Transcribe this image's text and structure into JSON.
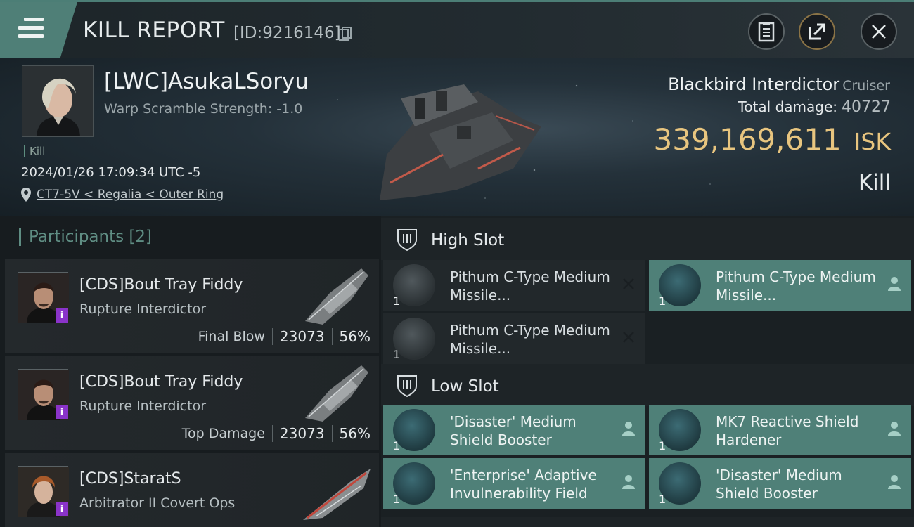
{
  "topbar": {
    "title": "KILL REPORT",
    "report_id": "[ID:9216146]",
    "icons": [
      "menu-icon",
      "copy-icon",
      "clipboard-icon",
      "share-icon",
      "close-icon"
    ]
  },
  "victim": {
    "name": "[LWC]AsukaLSoryu",
    "warp_scramble": "Warp Scramble Strength: -1.0",
    "kill_tag": "Kill",
    "datetime": "2024/01/26 17:09:34 UTC -5",
    "location": "CT7-5V < Regalia < Outer Ring",
    "ship_name": "Blackbird Interdictor",
    "ship_class": "Cruiser",
    "total_damage_label": "Total damage:",
    "total_damage": "40727",
    "isk_value": "339,169,611",
    "isk_unit": "ISK",
    "result": "Kill"
  },
  "participants": {
    "label": "Participants",
    "count": "[2]",
    "items": [
      {
        "name": "[CDS]Bout Tray Fiddy",
        "ship": "Rupture Interdictor",
        "role": "Final Blow",
        "damage": "23073",
        "percent": "56%"
      },
      {
        "name": "[CDS]Bout Tray Fiddy",
        "ship": "Rupture Interdictor",
        "role": "Top Damage",
        "damage": "23073",
        "percent": "56%"
      },
      {
        "name": "[CDS]StaratS",
        "ship": "Arbitrator II Covert Ops",
        "role": "",
        "damage": "",
        "percent": ""
      }
    ],
    "badge": "i"
  },
  "slots": {
    "high": {
      "label": "High Slot",
      "modules": [
        {
          "qty": "1",
          "name": "Pithum C-Type Medium Missile...",
          "state": "destroyed"
        },
        {
          "qty": "1",
          "name": "Pithum C-Type Medium Missile...",
          "state": "dropped"
        },
        {
          "qty": "1",
          "name": "Pithum C-Type Medium Missile...",
          "state": "destroyed"
        }
      ]
    },
    "low": {
      "label": "Low Slot",
      "modules": [
        {
          "qty": "1",
          "name": "'Disaster' Medium Shield Booster",
          "state": "dropped"
        },
        {
          "qty": "1",
          "name": "MK7 Reactive Shield Hardener",
          "state": "dropped"
        },
        {
          "qty": "1",
          "name": "'Enterprise' Adaptive Invulnerability Field",
          "state": "dropped"
        },
        {
          "qty": "1",
          "name": "'Disaster' Medium Shield Booster",
          "state": "dropped"
        }
      ]
    }
  },
  "colors": {
    "accent": "#4f8078",
    "isk": "#e8c57f",
    "badge": "#8a33c9"
  }
}
